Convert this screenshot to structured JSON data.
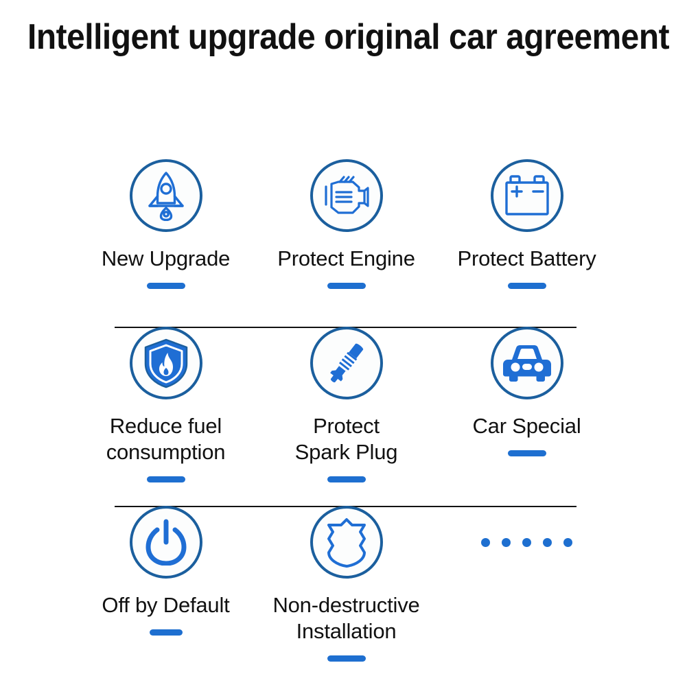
{
  "header": {
    "title": "Intelligent upgrade original car agreement"
  },
  "colors": {
    "ring": "#1b5f9e",
    "accent": "#1e6fd0",
    "icon_fill": "#1f6ed4",
    "text": "#111111",
    "divider": "#121212",
    "background": "#ffffff"
  },
  "features": [
    {
      "id": "new-upgrade",
      "label": "New Upgrade",
      "icon": "rocket-icon",
      "underline": true
    },
    {
      "id": "protect-engine",
      "label": "Protect Engine",
      "icon": "engine-icon",
      "underline": true
    },
    {
      "id": "protect-battery",
      "label": "Protect Battery",
      "icon": "battery-icon",
      "underline": true
    },
    {
      "id": "reduce-fuel-consumption",
      "label": "Reduce fuel\nconsumption",
      "icon": "shield-flame-icon",
      "underline": true
    },
    {
      "id": "protect-spark-plug",
      "label": "Protect\nSpark Plug",
      "icon": "spark-plug-icon",
      "underline": true
    },
    {
      "id": "car-special",
      "label": "Car Special",
      "icon": "car-front-icon",
      "underline": true
    },
    {
      "id": "off-by-default",
      "label": "Off by Default",
      "icon": "power-button-icon",
      "underline": true
    },
    {
      "id": "non-destructive-installation",
      "label": "Non-destructive\nInstallation",
      "icon": "shield-badge-icon",
      "underline": true
    },
    {
      "id": "more-features",
      "label": "",
      "icon": "ellipsis-dots-icon",
      "underline": false,
      "dot_count": 5
    }
  ]
}
